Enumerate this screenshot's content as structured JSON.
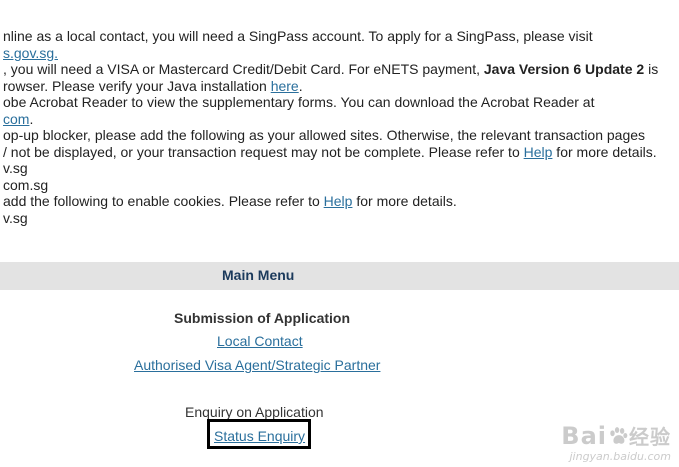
{
  "notes": {
    "line1": "nline as a local contact, you will need a SingPass account. To apply for a SingPass, please visit",
    "line2_link": "s.gov.sg.",
    "line3_pre": ", you will need a VISA or Mastercard Credit/Debit Card. For eNETS payment, ",
    "line3_bold": "Java Version 6 Update 2",
    "line3_post": " is",
    "line4_pre": "rowser. Please verify your Java installation ",
    "line4_link": "here",
    "line4_post": ".",
    "line5": "obe Acrobat Reader to view the supplementary forms. You can download the Acrobat Reader at",
    "line6_link": "com",
    "line6_post": ".",
    "line7": "op-up blocker, please add the following as your allowed sites. Otherwise, the relevant transaction pages",
    "line8_pre": "/ not be displayed, or your transaction request may not be complete. Please refer to ",
    "line8_link": "Help",
    "line8_post": " for more details.",
    "line9": "v.sg",
    "line10": "com.sg",
    "line11_pre": " add the following to enable cookies. Please refer to ",
    "line11_link": "Help",
    "line11_post": " for more details.",
    "line12": "v.sg"
  },
  "menu": {
    "title": "Main Menu",
    "submission_heading": "Submission of Application",
    "local_contact": "Local Contact",
    "visa_agent": "Authorised Visa Agent/Strategic Partner",
    "enquiry_heading": "Enquiry on Application",
    "status_enquiry": "Status Enquiry"
  },
  "watermark": {
    "logo": "Bai",
    "logo_suffix": "经验",
    "url": "jingyan.baidu.com"
  }
}
